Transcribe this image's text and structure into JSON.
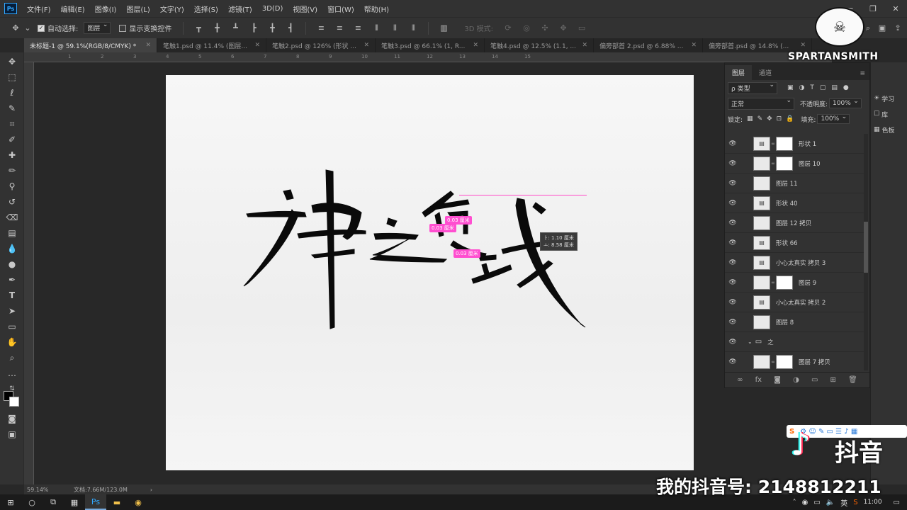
{
  "menubar": {
    "app_icon": "Ps",
    "items": [
      "文件(F)",
      "编辑(E)",
      "图像(I)",
      "图层(L)",
      "文字(Y)",
      "选择(S)",
      "滤镜(T)",
      "3D(D)",
      "视图(V)",
      "窗口(W)",
      "帮助(H)"
    ]
  },
  "options": {
    "auto_select_label": "自动选择:",
    "auto_select_value": "图层",
    "show_transform_label": "显示变换控件",
    "mode_3d_label": "3D 模式:"
  },
  "tabs": [
    {
      "label": "未标题-1 @ 59.1%(RGB/8/CMYK) *",
      "active": true
    },
    {
      "label": "笔触1.psd @ 11.4% (图层..."
    },
    {
      "label": "笔触2.psd @ 126% (形状 ..."
    },
    {
      "label": "笔触3.psd @ 66.1% (1, R..."
    },
    {
      "label": "笔触4.psd @ 12.5% (1.1, ..."
    },
    {
      "label": "偏旁部首 2.psd @ 6.88% ..."
    },
    {
      "label": "偏旁部首.psd @ 14.8% (..."
    }
  ],
  "ruler": {
    "marks": [
      "1",
      "2",
      "3",
      "4",
      "5",
      "6",
      "7",
      "8",
      "9",
      "10",
      "11",
      "12",
      "13",
      "14",
      "15"
    ]
  },
  "artwork": {
    "chars": [
      "神",
      "之",
      "领",
      "域"
    ]
  },
  "overlays": {
    "measure1": "0.03 厘米",
    "measure2": "0.03 厘米",
    "measure3": "0.03 厘米",
    "tooltip_line1": "ㅏ: 1.10 厘米",
    "tooltip_line2": "ㅗ: 8.58 厘米"
  },
  "status": {
    "zoom": "59.14%",
    "doc": "文档:7.66M/123.0M"
  },
  "layers_panel": {
    "tab_layers": "图层",
    "tab_channels": "通道",
    "filter_label": "ρ 类型",
    "blend_mode": "正常",
    "opacity_label": "不透明度:",
    "opacity_value": "100%",
    "lock_label": "锁定:",
    "fill_label": "填充:",
    "fill_value": "100%",
    "layers": [
      {
        "name": "形状 1",
        "mask": true
      },
      {
        "name": "图层 10",
        "mask": true
      },
      {
        "name": "图层 11",
        "mask": false
      },
      {
        "name": "形状 40",
        "mask": false
      },
      {
        "name": "图层 12 拷贝",
        "mask": false
      },
      {
        "name": "形状 66",
        "mask": false
      },
      {
        "name": "小心太真实 拷贝 3",
        "mask": false
      },
      {
        "name": "图层 9",
        "mask": true
      },
      {
        "name": "小心太真实 拷贝 2",
        "mask": false
      },
      {
        "name": "图层 8",
        "mask": false
      },
      {
        "name": "之",
        "group": true
      },
      {
        "name": "图层 7 拷贝",
        "mask": true
      }
    ]
  },
  "dock": {
    "learn": "学习",
    "library": "库",
    "swatches": "色板"
  },
  "watermark": {
    "text": "SPARTANSMITH"
  },
  "douyin": {
    "name": "抖音",
    "id": "我的抖音号: 2148812211"
  },
  "taskbar": {
    "time": "11:00",
    "lang": "英"
  }
}
